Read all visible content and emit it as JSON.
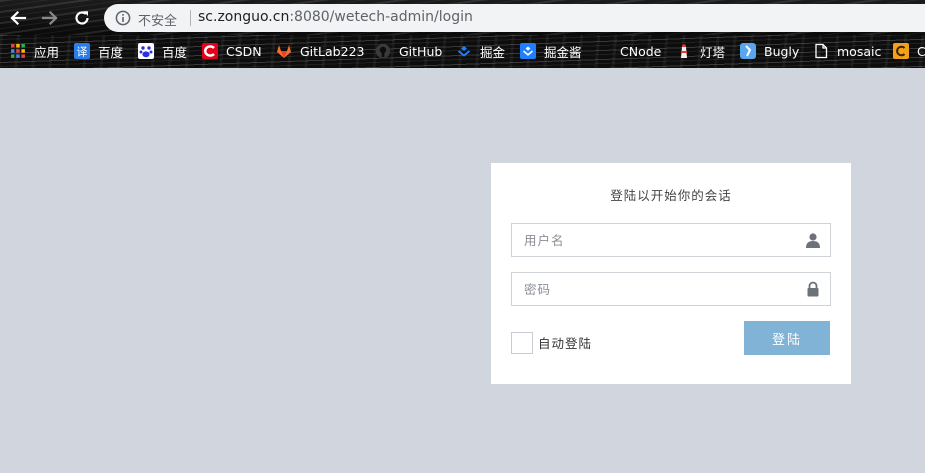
{
  "browser": {
    "security_label": "不安全",
    "url_host": "sc.zonguo.cn",
    "url_rest": ":8080/wetech-admin/login"
  },
  "bookmarks": [
    {
      "label": "应用",
      "icon": "apps-grid-icon"
    },
    {
      "label": "百度",
      "icon": "translate-icon"
    },
    {
      "label": "百度",
      "icon": "baidu-paw-icon"
    },
    {
      "label": "CSDN",
      "icon": "csdn-icon"
    },
    {
      "label": "GitLab223",
      "icon": "gitlab-icon"
    },
    {
      "label": "GitHub",
      "icon": "github-icon"
    },
    {
      "label": "掘金",
      "icon": "juejin-icon"
    },
    {
      "label": "掘金酱",
      "icon": "juejin-sauce-icon"
    },
    {
      "label": "CNode",
      "icon": "cnode-icon"
    },
    {
      "label": "灯塔",
      "icon": "lighthouse-icon"
    },
    {
      "label": "Bugly",
      "icon": "bugly-icon"
    },
    {
      "label": "mosaic",
      "icon": "page-icon"
    },
    {
      "label": "C",
      "icon": "orange-c-icon"
    }
  ],
  "login": {
    "title": "登陆以开始你的会话",
    "username_placeholder": "用户名",
    "password_placeholder": "密码",
    "remember_label": "自动登陆",
    "submit_label": "登陆"
  },
  "colors": {
    "page_bg": "#d1d5de",
    "button_bg": "#80b3d5",
    "card_bg": "#ffffff"
  }
}
